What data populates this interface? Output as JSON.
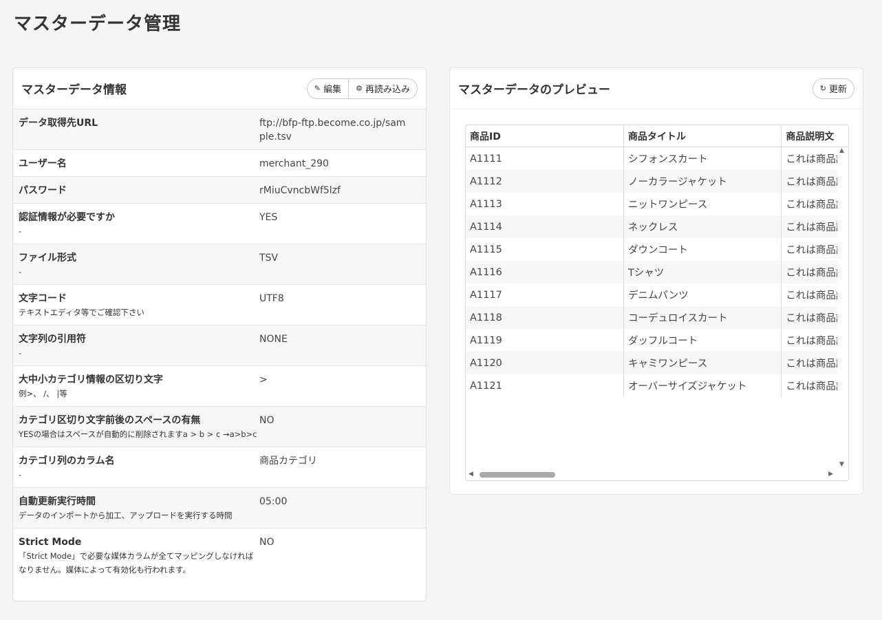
{
  "page_title": "マスターデータ管理",
  "info_panel": {
    "title": "マスターデータ情報",
    "edit_label": "編集",
    "reload_label": "再読み込み",
    "rows": [
      {
        "label": "データ取得先URL",
        "note": "",
        "value": "ftp://bfp-ftp.become.co.jp/sample.tsv"
      },
      {
        "label": "ユーザー名",
        "note": "",
        "value": "merchant_290"
      },
      {
        "label": "パスワード",
        "note": "",
        "value": "rMiuCvncbWf5lzf"
      },
      {
        "label": "認証情報が必要ですか",
        "note": "-",
        "value": "YES"
      },
      {
        "label": "ファイル形式",
        "note": "-",
        "value": "TSV"
      },
      {
        "label": "文字コード",
        "note": "テキストエディタ等でご確認下さい",
        "value": "UTF8"
      },
      {
        "label": "文字列の引用符",
        "note": "-",
        "value": "NONE"
      },
      {
        "label": "大中小カテゴリ情報の区切り文字",
        "note": "例>、 /、 |等",
        "value": ">"
      },
      {
        "label": "カテゴリ区切り文字前後のスペースの有無",
        "note": "YESの場合はスペースが自動的に削除されますa > b > c →a>b>c",
        "value": "NO"
      },
      {
        "label": "カテゴリ列のカラム名",
        "note": "-",
        "value": "商品カテゴリ"
      },
      {
        "label": "自動更新実行時間",
        "note": "データのインポートから加工、アップロードを実行する時間",
        "value": "05:00"
      },
      {
        "label": "Strict Mode",
        "note": "「Strict Mode」で必要な媒体カラムが全てマッピングしなければなりません。媒体によって有効化も行われます。",
        "value": "NO"
      }
    ]
  },
  "preview_panel": {
    "title": "マスターデータのプレビュー",
    "refresh_label": "更新",
    "columns": [
      "商品ID",
      "商品タイトル",
      "商品説明文"
    ],
    "rows": [
      [
        "A1111",
        "シフォンスカート",
        "これは商品説明文です"
      ],
      [
        "A1112",
        "ノーカラージャケット",
        "これは商品説明文です"
      ],
      [
        "A1113",
        "ニットワンピース",
        "これは商品説明文です"
      ],
      [
        "A1114",
        "ネックレス",
        "これは商品説明文です"
      ],
      [
        "A1115",
        "ダウンコート",
        "これは商品説明文です"
      ],
      [
        "A1116",
        "Tシャツ",
        "これは商品説明文です"
      ],
      [
        "A1117",
        "デニムパンツ",
        "これは商品説明文です"
      ],
      [
        "A1118",
        "コーデュロイスカート",
        "これは商品説明文です"
      ],
      [
        "A1119",
        "ダッフルコート",
        "これは商品説明文です"
      ],
      [
        "A1120",
        "キャミワンピース",
        "これは商品説明文です"
      ],
      [
        "A1121",
        "オーバーサイズジャケット",
        "これは商品説明文です"
      ]
    ]
  }
}
